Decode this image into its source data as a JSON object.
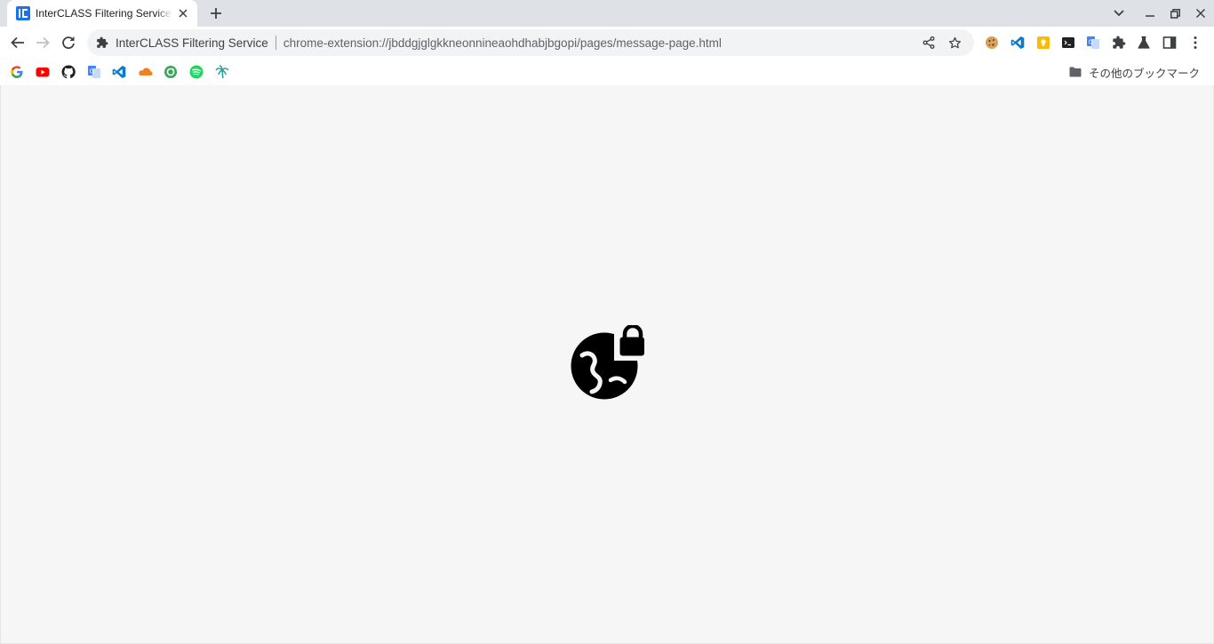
{
  "tab": {
    "title": "InterCLASS Filtering Service - Blocked",
    "favicon": "interclass-logo-icon",
    "accent": "#1a73e8"
  },
  "omnibox": {
    "site_name": "InterCLASS Filtering Service",
    "url": "chrome-extension://jbddgjglgkkneonnineaohdhabjbgopi/pages/message-page.html"
  },
  "toolbar": {
    "extensions": [
      "cookie-icon",
      "vscode-icon",
      "keep-icon",
      "terminal-icon",
      "translate-icon",
      "puzzle-icon",
      "labs-flask-icon",
      "side-panel-icon",
      "more-menu-icon"
    ]
  },
  "bookmarks": {
    "items": [
      "google-icon",
      "youtube-icon",
      "github-icon",
      "translate-icon",
      "vscode-icon",
      "cloudflare-icon",
      "refresh-circle-icon",
      "spotify-icon",
      "palm-tree-icon"
    ],
    "other_label": "その他のブックマーク"
  },
  "content": {
    "icon": "vpn-lock-icon",
    "background": "#f6f6f6"
  }
}
